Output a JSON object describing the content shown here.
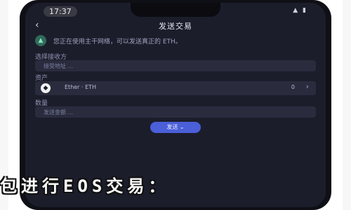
{
  "status": {
    "time": "17:37",
    "icons": "▲ ▮"
  },
  "nav": {
    "title": "发送交易",
    "back_icon": "chevron-left-icon"
  },
  "notice": {
    "icon": "warning-icon",
    "text": "您正在使用主干网络，可以发送真正的 ETH。"
  },
  "network": {
    "label": "选择接收方",
    "placeholder": "接受地址 ..."
  },
  "asset": {
    "label": "资产",
    "name": "Ether · ETH",
    "balance": "0"
  },
  "amount": {
    "label": "数量",
    "placeholder": "发送金额 ..."
  },
  "send": {
    "label": "发送"
  },
  "banner": {
    "text": "包进行EOS交易："
  },
  "colors": {
    "accent": "#4a5fd8",
    "background": "#1c1d2b",
    "field": "#2a2c3e"
  }
}
